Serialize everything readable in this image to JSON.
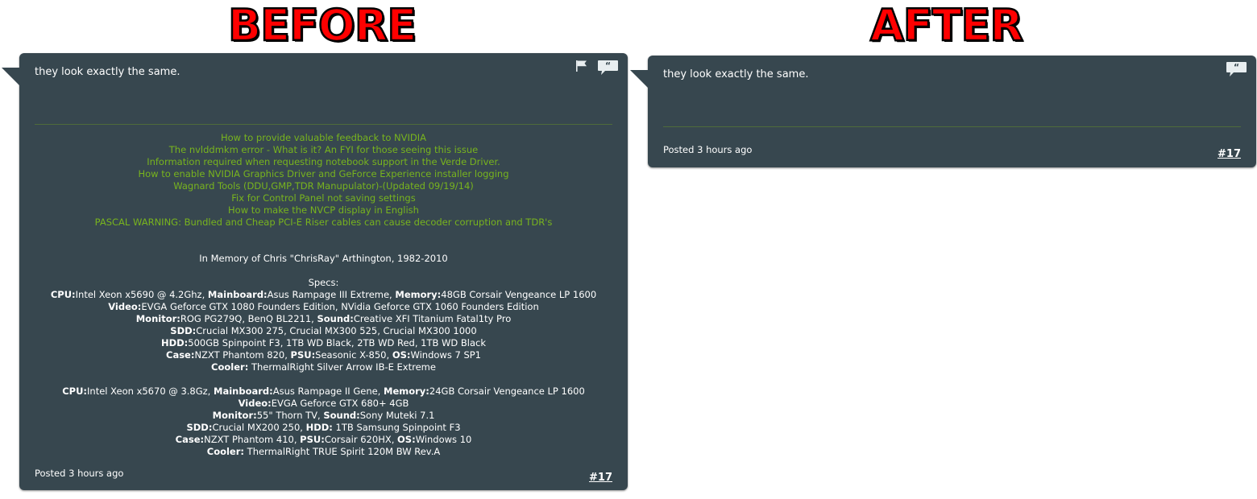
{
  "labels": {
    "before": "BEFORE",
    "after": "AFTER"
  },
  "colors": {
    "post_background": "#37474f",
    "link_green": "#78b41e",
    "heading_red": "#ff0000"
  },
  "before_post": {
    "message": "they look exactly the same.",
    "icons": [
      "flag-icon",
      "quote-icon"
    ],
    "signature": {
      "links": [
        "How to provide valuable feedback to NVIDIA",
        "The nvlddmkm error - What is it? An FYI for those seeing this issue",
        "Information required when requesting notebook support in the Verde Driver.",
        "How to enable NVIDIA Graphics Driver and GeForce Experience installer logging",
        "Wagnard Tools (DDU,GMP,TDR Manupulator)-(Updated 09/19/14)",
        "Fix for Control Panel not saving settings",
        "How to make the NVCP display in English",
        "PASCAL WARNING: Bundled and Cheap PCI-E Riser cables can cause decoder corruption and TDR's"
      ],
      "memory": "In Memory of Chris \"ChrisRay\" Arthington, 1982-2010",
      "specs_label": "Specs:",
      "rig1": {
        "cpu_label": "CPU:",
        "cpu": "Intel Xeon x5690 @ 4.2Ghz, ",
        "mainboard_label": "Mainboard:",
        "mainboard": "Asus Rampage III Extreme, ",
        "memory_label": "Memory:",
        "memory": "48GB Corsair Vengeance LP 1600",
        "video_label": "Video:",
        "video": "EVGA Geforce GTX 1080 Founders Edition, NVidia Geforce GTX 1060 Founders Edition",
        "monitor_label": "Monitor:",
        "monitor": "ROG PG279Q, BenQ BL2211, ",
        "sound_label": "Sound:",
        "sound": "Creative XFI Titanium Fatal1ty Pro",
        "ssd_label": "SDD:",
        "ssd": "Crucial MX300 275, Crucial MX300 525, Crucial MX300 1000",
        "hdd_label": "HDD:",
        "hdd": "500GB Spinpoint F3, 1TB WD Black, 2TB WD Red, 1TB WD Black",
        "case_label": "Case:",
        "case": "NZXT Phantom 820, ",
        "psu_label": "PSU:",
        "psu": "Seasonic X-850, ",
        "os_label": "OS:",
        "os": "Windows 7 SP1",
        "cooler_label": "Cooler:",
        "cooler": " ThermalRight Silver Arrow IB-E Extreme"
      },
      "rig2": {
        "cpu_label": "CPU:",
        "cpu": "Intel Xeon x5670 @ 3.8Gz, ",
        "mainboard_label": "Mainboard:",
        "mainboard": "Asus Rampage II Gene, ",
        "memory_label": "Memory:",
        "memory": "24GB Corsair Vengeance LP 1600",
        "video_label": "Video:",
        "video": "EVGA Geforce GTX 680+ 4GB",
        "monitor_label": "Monitor:",
        "monitor": "55\" Thorn TV, ",
        "sound_label": "Sound:",
        "sound": "Sony Muteki 7.1",
        "ssd_label": "SDD:",
        "ssd": "Crucial MX200 250, ",
        "hdd_label": "HDD:",
        "hdd": " 1TB Samsung Spinpoint F3",
        "case_label": "Case:",
        "case": "NZXT Phantom 410, ",
        "psu_label": "PSU:",
        "psu": "Corsair 620HX, ",
        "os_label": "OS:",
        "os": "Windows 10",
        "cooler_label": "Cooler:",
        "cooler": " ThermalRight TRUE Spirit 120M BW Rev.A"
      }
    },
    "posted": "Posted 3 hours ago",
    "post_number": "#17"
  },
  "after_post": {
    "message": "they look exactly the same.",
    "icons": [
      "quote-icon"
    ],
    "posted": "Posted 3 hours ago",
    "post_number": "#17"
  }
}
